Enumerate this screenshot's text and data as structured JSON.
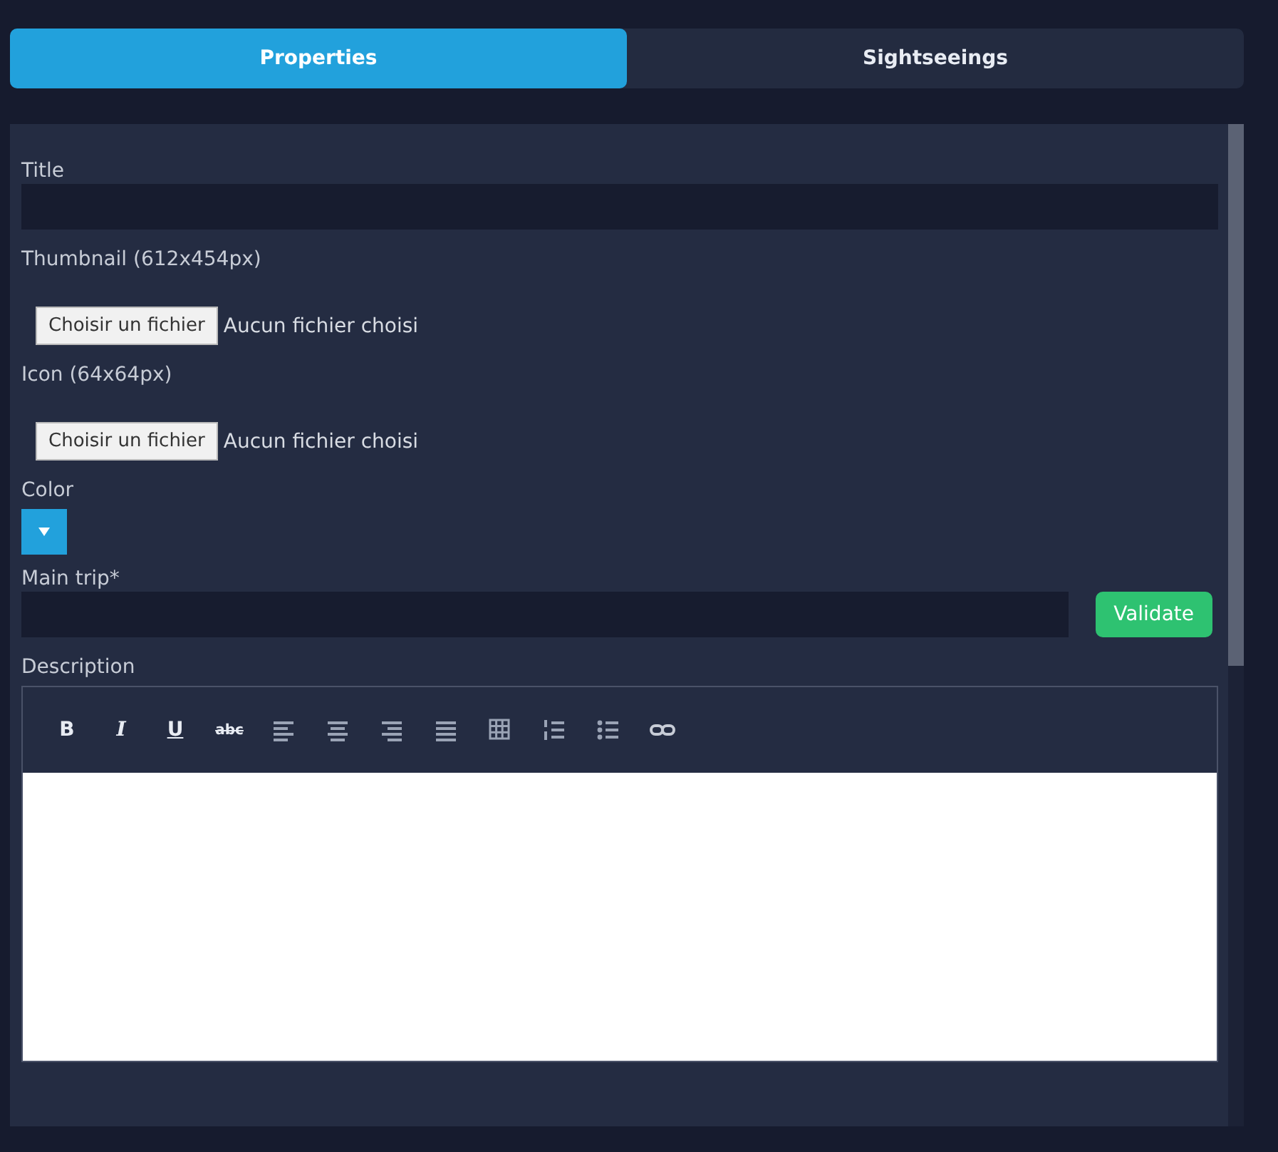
{
  "tabs": [
    {
      "label": "Properties",
      "selected": true
    },
    {
      "label": "Sightseeings",
      "selected": false
    }
  ],
  "form": {
    "fields": [
      {
        "kind": "text",
        "label": "Title"
      },
      {
        "kind": "file",
        "label": "Thumbnail (612x454px)",
        "button": "Choisir un fichier",
        "status": "Aucun fichier choisi"
      },
      {
        "kind": "file",
        "label": "Icon (64x64px)",
        "button": "Choisir un fichier",
        "status": "Aucun fichier choisi"
      },
      {
        "kind": "color",
        "label": "Color",
        "color": "#22a1dc"
      },
      {
        "kind": "text-validate",
        "label": "Main trip*",
        "button": "Validate"
      },
      {
        "kind": "editor",
        "label": "Description",
        "toolbar": [
          {
            "kind": "bold",
            "label": "B"
          },
          {
            "kind": "italic",
            "label": "I"
          },
          {
            "kind": "underline",
            "label": "U"
          },
          {
            "kind": "strike",
            "label": "abc"
          },
          {
            "kind": "align-left"
          },
          {
            "kind": "align-center"
          },
          {
            "kind": "align-right"
          },
          {
            "kind": "justify"
          },
          {
            "kind": "table"
          },
          {
            "kind": "ordered-list"
          },
          {
            "kind": "bullet-list"
          },
          {
            "kind": "link"
          }
        ]
      }
    ]
  }
}
